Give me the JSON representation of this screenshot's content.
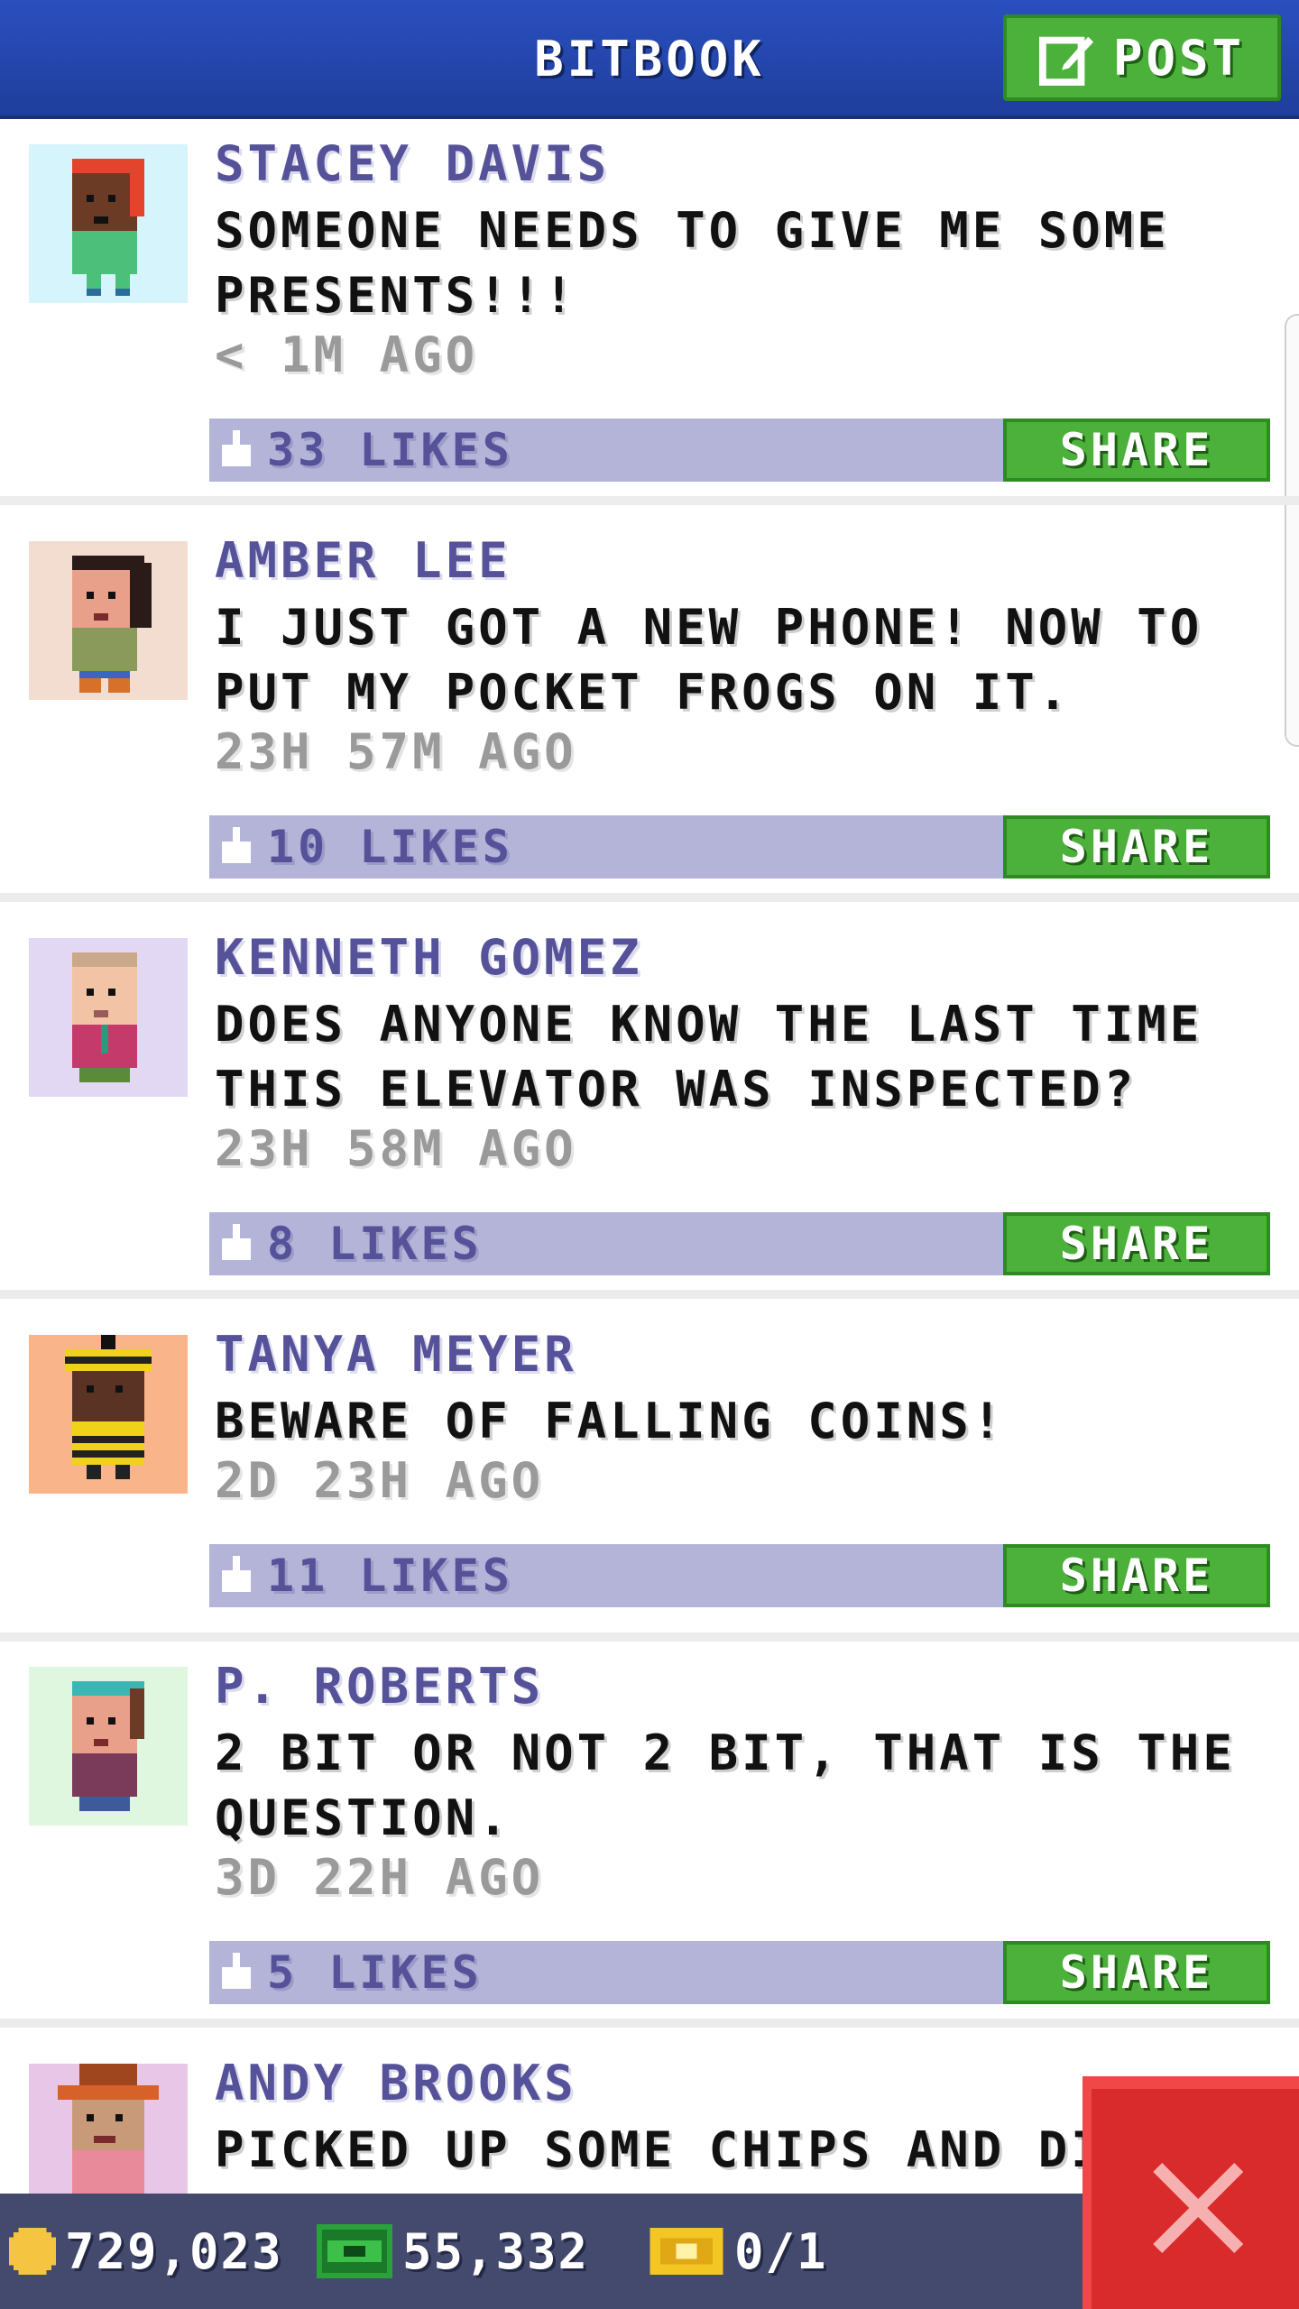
{
  "header": {
    "title": "BITBOOK",
    "post_label": "POST"
  },
  "posts": [
    {
      "author": "STACEY DAVIS",
      "message": "SOMEONE NEEDS TO GIVE ME SOME PRESENTS!!!",
      "time": "< 1M AGO",
      "likes": "33 LIKES",
      "share": "SHARE",
      "avatar_bg": "#d6f4fb"
    },
    {
      "author": "AMBER LEE",
      "message": "I JUST GOT A NEW PHONE! NOW TO PUT MY POCKET FROGS ON IT.",
      "time": "23H 57M AGO",
      "likes": "10 LIKES",
      "share": "SHARE",
      "avatar_bg": "#f3ddd0"
    },
    {
      "author": "KENNETH GOMEZ",
      "message": "DOES ANYONE KNOW THE LAST TIME THIS ELEVATOR WAS INSPECTED?",
      "time": "23H 58M AGO",
      "likes": "8 LIKES",
      "share": "SHARE",
      "avatar_bg": "#e3d8f4"
    },
    {
      "author": "TANYA MEYER",
      "message": "BEWARE OF FALLING COINS!",
      "time": "2D 23H AGO",
      "likes": "11 LIKES",
      "share": "SHARE",
      "avatar_bg": "#f9b48a"
    },
    {
      "author": "P. ROBERTS",
      "message": "2 BIT OR NOT 2 BIT, THAT IS THE QUESTION.",
      "time": "3D 22H AGO",
      "likes": "5 LIKES",
      "share": "SHARE",
      "avatar_bg": "#dff6df"
    },
    {
      "author": "ANDY BROOKS",
      "message": "PICKED UP SOME CHIPS AND DIP",
      "avatar_bg": "#e8c6e8"
    }
  ],
  "status": {
    "coins": "729,023",
    "bux": "55,332",
    "tickets": "0/1"
  },
  "colors": {
    "header": "#2a4fbf",
    "green": "#4cb13b",
    "likes_bar": "#b3b4d8",
    "close": "#d92b2b"
  }
}
